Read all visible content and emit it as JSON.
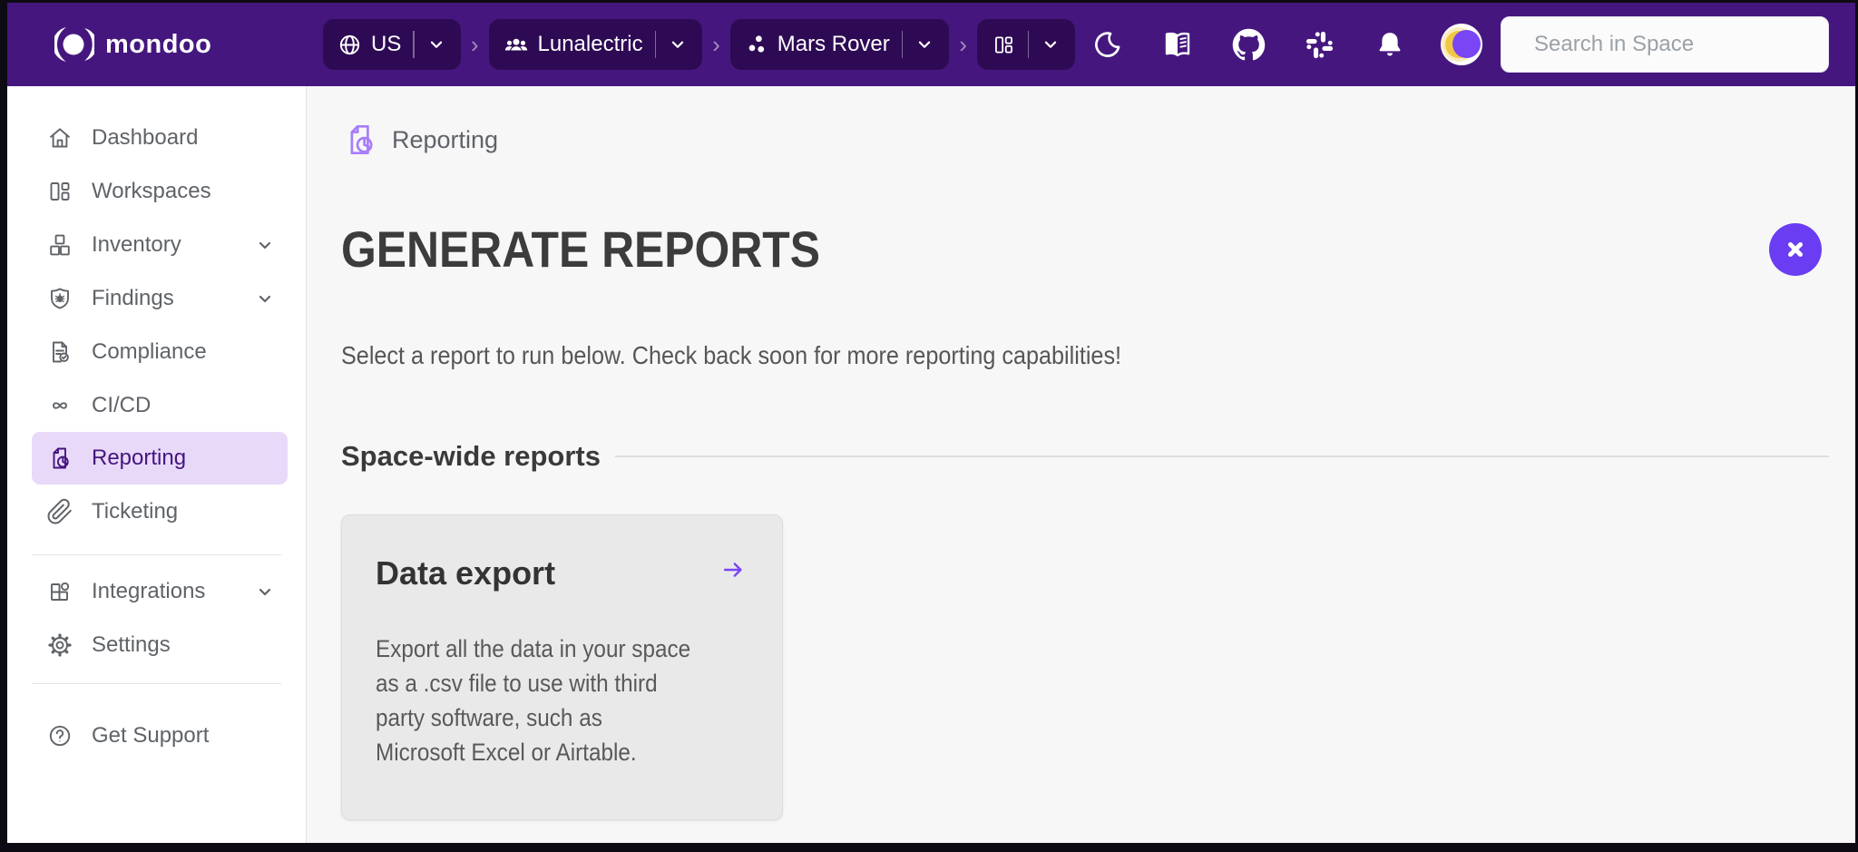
{
  "topbar": {
    "brand": "mondoo",
    "separator": "›",
    "region": {
      "label": "US",
      "icon": "globe-icon"
    },
    "org": {
      "label": "Lunalectric",
      "icon": "people-icon"
    },
    "space": {
      "label": "Mars Rover",
      "icon": "space-dots-icon"
    },
    "workspace_switcher": {
      "icon": "workspaces-icon"
    },
    "utility_icons": [
      "dark-mode-moon-icon",
      "docs-book-icon",
      "github-icon",
      "slack-icon",
      "notifications-bell-icon"
    ],
    "search": {
      "placeholder": "Search in Space",
      "icon": "search-icon"
    }
  },
  "sidebar": {
    "items": [
      {
        "label": "Dashboard",
        "icon": "home-icon",
        "expandable": false,
        "active": false
      },
      {
        "label": "Workspaces",
        "icon": "workspaces-icon",
        "expandable": false,
        "active": false
      },
      {
        "label": "Inventory",
        "icon": "inventory-icon",
        "expandable": true,
        "active": false
      },
      {
        "label": "Findings",
        "icon": "findings-icon",
        "expandable": true,
        "active": false
      },
      {
        "label": "Compliance",
        "icon": "compliance-icon",
        "expandable": false,
        "active": false
      },
      {
        "label": "CI/CD",
        "icon": "cicd-icon",
        "expandable": false,
        "active": false
      },
      {
        "label": "Reporting",
        "icon": "reporting-icon",
        "expandable": false,
        "active": true
      },
      {
        "label": "Ticketing",
        "icon": "ticketing-icon",
        "expandable": false,
        "active": false
      }
    ],
    "secondary": [
      {
        "label": "Integrations",
        "icon": "integrations-icon",
        "expandable": true
      },
      {
        "label": "Settings",
        "icon": "settings-icon",
        "expandable": false
      }
    ],
    "footer": [
      {
        "label": "Get Support",
        "icon": "help-icon"
      }
    ]
  },
  "main": {
    "breadcrumb": {
      "label": "Reporting",
      "icon": "reporting-icon"
    },
    "title": "GENERATE REPORTS",
    "subtitle": "Select a report to run below. Check back soon for more reporting capabilities!",
    "section": {
      "title": "Space-wide reports"
    },
    "cards": [
      {
        "title": "Data export",
        "description": "Export all the data in your space as a .csv file to use with third party software, such as Microsoft Excel or Airtable."
      }
    ]
  },
  "colors": {
    "topbar": "#45177E",
    "topbar_pill": "#2E0A54",
    "accent_purple": "#7A45F5",
    "close_button": "#6A3DF2",
    "active_item_bg": "#E8D9F9",
    "active_item_text": "#45157E",
    "breadcrumb_icon": "#A87CF8",
    "main_bg": "#F7F7F8",
    "card_bg": "#E9E9EA"
  }
}
